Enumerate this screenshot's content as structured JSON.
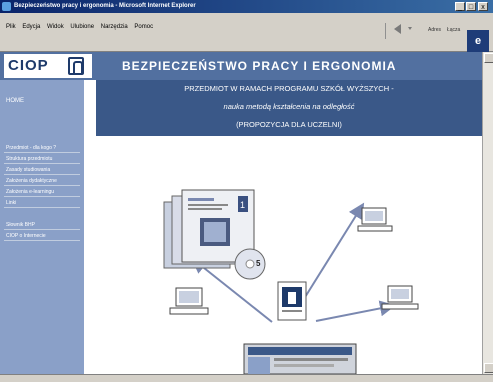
{
  "window": {
    "title": "Bezpieczeństwo pracy i ergonomia - Microsoft Internet Explorer",
    "minimize_glyph": "_",
    "maximize_glyph": "□",
    "close_glyph": "x"
  },
  "menu": {
    "items": [
      "Plik",
      "Edycja",
      "Widok",
      "Ulubione",
      "Narzędzia",
      "Pomoc"
    ]
  },
  "toolbar": {
    "links_label": "Adres",
    "links2_label": "Łącza",
    "ie_logo_glyph": "e"
  },
  "header": {
    "logo_text": "CIOP",
    "site_title": "BEZPIECZEŃSTWO PRACY I ERGONOMIA"
  },
  "sidebar": {
    "home": "HOME",
    "items": [
      "Przedmiot - dla kogo ?",
      "Struktura przedmiotu",
      "Zasady studiowania",
      "Założenia dydaktyczne",
      "Założenia e-learningu",
      "Linki",
      "Słownik BHP",
      "CIOP o Internecie"
    ]
  },
  "banner": {
    "line1": "PRZEDMIOT W RAMACH PROGRAMU SZKÓŁ WYŻSZYCH -",
    "line2": "nauka metodą kształcenia na odległość",
    "line3": "(PROPOZYCJA DLA UCZELNI)"
  },
  "book": {
    "volume_number": "1",
    "cd_number": "5"
  },
  "colors": {
    "header": "#5270a0",
    "sidebar": "#8aa0c8",
    "banner": "#3a5888",
    "arrows": "#7a88b0"
  }
}
